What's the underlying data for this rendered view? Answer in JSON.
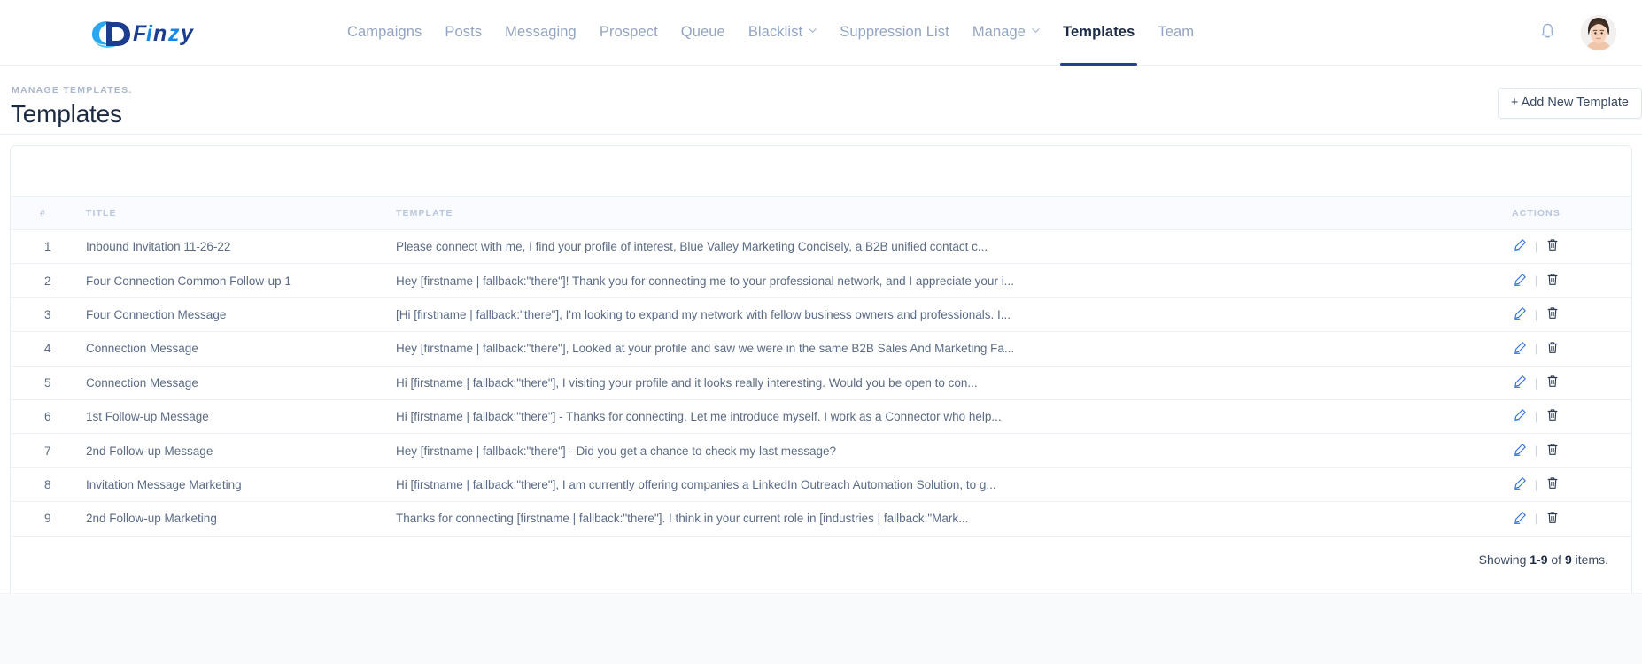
{
  "brand": {
    "name": "Finzy",
    "logo_icon": "finzy-swoosh-logo",
    "accent": "#1786e8",
    "dark": "#1b3d8f"
  },
  "nav": {
    "items": [
      {
        "label": "Campaigns",
        "active": false,
        "caret": false
      },
      {
        "label": "Posts",
        "active": false,
        "caret": false
      },
      {
        "label": "Messaging",
        "active": false,
        "caret": false
      },
      {
        "label": "Prospect",
        "active": false,
        "caret": false
      },
      {
        "label": "Queue",
        "active": false,
        "caret": false
      },
      {
        "label": "Blacklist",
        "active": false,
        "caret": true
      },
      {
        "label": "Suppression List",
        "active": false,
        "caret": false
      },
      {
        "label": "Manage",
        "active": false,
        "caret": true
      },
      {
        "label": "Templates",
        "active": true,
        "caret": false
      },
      {
        "label": "Team",
        "active": false,
        "caret": false
      }
    ],
    "notifications_icon": "bell-icon",
    "avatar_icon": "user-avatar-photo"
  },
  "page": {
    "eyebrow": "MANAGE TEMPLATES.",
    "title": "Templates",
    "add_button": "+ Add New Template"
  },
  "table": {
    "headers": {
      "number": "#",
      "title": "TITLE",
      "template": "TEMPLATE",
      "actions": "ACTIONS"
    },
    "edit_icon": "pencil-edit-icon",
    "delete_icon": "trash-delete-icon",
    "separator": "|",
    "rows": [
      {
        "num": "1",
        "title": "Inbound Invitation 11-26-22",
        "template": "Please connect with me, I find your profile of interest, Blue Valley Marketing Concisely, a B2B unified contact c..."
      },
      {
        "num": "2",
        "title": "Four Connection Common Follow-up 1",
        "template": "Hey [firstname | fallback:\"there\"]! Thank you for connecting me to your professional network, and I appreciate your i..."
      },
      {
        "num": "3",
        "title": "Four Connection Message",
        "template": "[Hi [firstname | fallback:\"there\"], I'm looking to expand my network with fellow business owners and professionals. I..."
      },
      {
        "num": "4",
        "title": "Connection Message",
        "template": "Hey [firstname | fallback:\"there\"], Looked at your profile and saw we were in the same B2B Sales And Marketing Fa..."
      },
      {
        "num": "5",
        "title": "Connection Message",
        "template": "Hi [firstname | fallback:\"there\"], I visiting your profile and it looks really interesting. Would you be open to con..."
      },
      {
        "num": "6",
        "title": "1st Follow-up Message",
        "template": "Hi [firstname | fallback:\"there\"] - Thanks for connecting. Let me introduce myself. I work as a Connector who help..."
      },
      {
        "num": "7",
        "title": "2nd Follow-up Message",
        "template": "Hey [firstname | fallback:\"there\"] - Did you get a chance to check my last message?"
      },
      {
        "num": "8",
        "title": "Invitation Message Marketing",
        "template": "Hi [firstname | fallback:\"there\"], I am currently offering companies a LinkedIn Outreach Automation Solution, to g..."
      },
      {
        "num": "9",
        "title": "2nd Follow-up Marketing",
        "template": "Thanks for connecting [firstname | fallback:\"there\"]. I think in your current role in [industries | fallback:\"Mark..."
      }
    ]
  },
  "footer": {
    "showing_prefix": "Showing ",
    "range": "1-9",
    "middle": " of ",
    "total": "9",
    "suffix": " items."
  }
}
